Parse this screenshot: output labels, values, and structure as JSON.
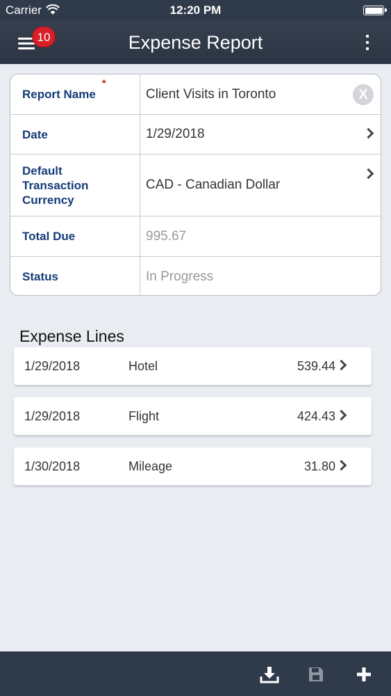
{
  "status_bar": {
    "carrier": "Carrier",
    "time": "12:20 PM"
  },
  "nav": {
    "title": "Expense Report",
    "notification_count": "10",
    "menu_icon": "hamburger-menu-icon",
    "more_icon": "more-vertical-icon"
  },
  "header": {
    "report_name": {
      "label": "Report Name",
      "required": "*",
      "value": "Client Visits in Toronto",
      "clear_icon": "X"
    },
    "date": {
      "label": "Date",
      "value": "1/29/2018"
    },
    "currency": {
      "label": "Default Transaction Currency",
      "value": "CAD - Canadian Dollar"
    },
    "total_due": {
      "label": "Total Due",
      "value": "995.67"
    },
    "status": {
      "label": "Status",
      "value": "In Progress"
    }
  },
  "expense_lines": {
    "title": "Expense Lines",
    "items": [
      {
        "date": "1/29/2018",
        "type": "Hotel",
        "amount": "539.44"
      },
      {
        "date": "1/29/2018",
        "type": "Flight",
        "amount": "424.43"
      },
      {
        "date": "1/30/2018",
        "type": "Mileage",
        "amount": "31.80"
      }
    ]
  },
  "toolbar": {
    "icons": [
      "download-icon",
      "save-icon",
      "add-icon"
    ]
  },
  "colors": {
    "bar": "#2f3a4a",
    "label": "#143b78",
    "badge": "#d71f2a",
    "background": "#e9ecf1"
  }
}
